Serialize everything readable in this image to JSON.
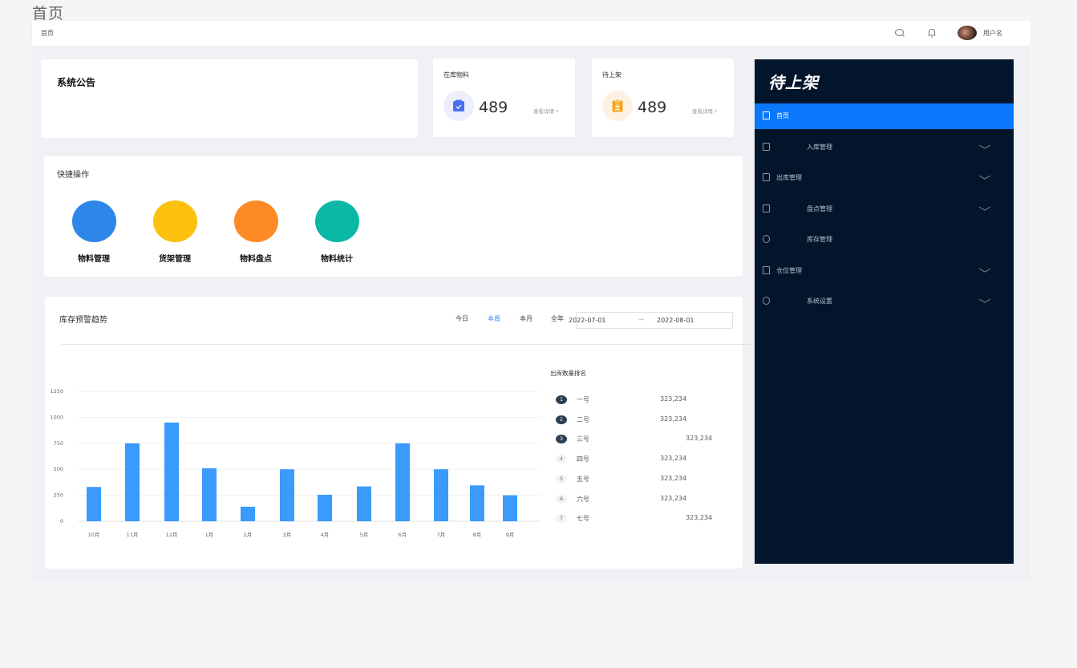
{
  "page": {
    "title": "首页"
  },
  "topbar": {
    "breadcrumb": "首页",
    "search_icon": "search-icon",
    "bell_icon": "bell-icon",
    "username": "用户名"
  },
  "notice": {
    "title": "系统公告"
  },
  "stats": [
    {
      "label": "在库物料",
      "value": "489",
      "detail": "查看详情",
      "icon": "clipboard-check-icon",
      "color": "#4a6ff0"
    },
    {
      "label": "待上架",
      "value": "489",
      "detail": "查看详情",
      "icon": "clipboard-download-icon",
      "color": "#f5a623"
    }
  ],
  "quick": {
    "title": "快捷操作",
    "items": [
      {
        "label": "物料管理",
        "color": "#2e86e8"
      },
      {
        "label": "货架管理",
        "color": "#fcc10f"
      },
      {
        "label": "物料盘点",
        "color": "#fd8a24"
      },
      {
        "label": "物料统计",
        "color": "#0bb8a6"
      }
    ]
  },
  "trend": {
    "title": "库存预警趋势",
    "tabs": [
      {
        "label": "今日",
        "active": false
      },
      {
        "label": "本周",
        "active": true
      },
      {
        "label": "本月",
        "active": false
      },
      {
        "label": "全年",
        "active": false
      }
    ],
    "date_start": "2022-07-01",
    "date_arrow": "→",
    "date_end": "2022-08-01"
  },
  "chart_data": {
    "type": "bar",
    "title": "库存预警趋势",
    "xlabel": "",
    "ylabel": "",
    "categories": [
      "10月",
      "11月",
      "12月",
      "1月",
      "2月",
      "3月",
      "4月",
      "5月",
      "6月",
      "7月",
      "8月",
      "9月"
    ],
    "values": [
      330,
      750,
      950,
      510,
      140,
      500,
      255,
      335,
      750,
      500,
      345,
      250
    ],
    "ylim": [
      0,
      1250
    ],
    "yticks": [
      0,
      250,
      500,
      750,
      1000,
      1250
    ],
    "grid": true,
    "bar_color": "#3a9bfc"
  },
  "ranking": {
    "title": "出库数量排名",
    "rows": [
      {
        "rank": "1",
        "name": "一号",
        "value": "323,234"
      },
      {
        "rank": "2",
        "name": "二号",
        "value": "323,234"
      },
      {
        "rank": "3",
        "name": "三号",
        "value": "323,234"
      },
      {
        "rank": "4",
        "name": "四号",
        "value": "323,234"
      },
      {
        "rank": "5",
        "name": "五号",
        "value": "323,234"
      },
      {
        "rank": "6",
        "name": "六号",
        "value": "323,234"
      },
      {
        "rank": "7",
        "name": "七号",
        "value": "323,234"
      }
    ]
  },
  "sidebar": {
    "brand": "待上架",
    "active_color": "#0a78fa",
    "items": [
      {
        "label": "首页",
        "icon": "home-icon",
        "active": true,
        "expandable": false
      },
      {
        "label": "入库管理",
        "icon": "inbound-icon",
        "active": false,
        "expandable": true
      },
      {
        "label": "出库管理",
        "icon": "outbound-icon",
        "active": false,
        "expandable": true
      },
      {
        "label": "盘点管理",
        "icon": "inventory-check-icon",
        "active": false,
        "expandable": true
      },
      {
        "label": "库存管理",
        "icon": "stock-icon",
        "active": false,
        "expandable": false
      },
      {
        "label": "仓位管理",
        "icon": "storage-location-icon",
        "active": false,
        "expandable": true
      },
      {
        "label": "系统设置",
        "icon": "settings-icon",
        "active": false,
        "expandable": true
      }
    ]
  }
}
